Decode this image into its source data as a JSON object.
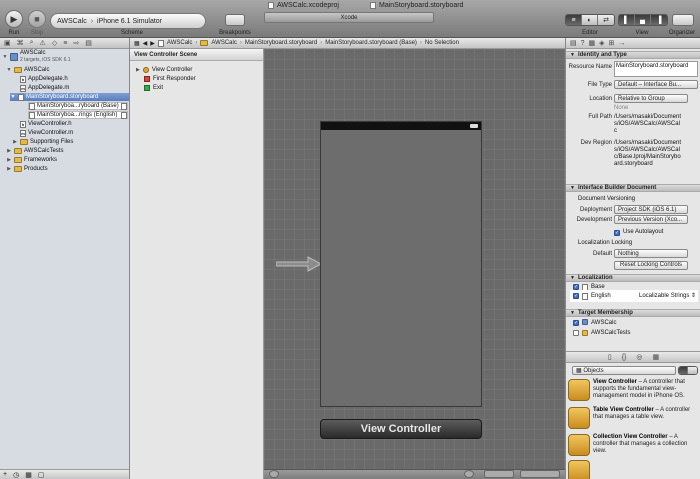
{
  "toolbar": {
    "run_label": "Run",
    "stop_label": "Stop",
    "scheme_label": "Scheme",
    "scheme_project": "AWSCalc",
    "scheme_device": "iPhone 6.1 Simulator",
    "breakpoints_label": "Breakpoints",
    "editor_label": "Editor",
    "view_label": "View",
    "organizer_label": "Organizer",
    "tab_xcodeproj": "AWSCalc.xcodeproj",
    "tab_storyboard": "MainStoryboard.storyboard",
    "xcode_tab": "Xcode"
  },
  "navigator": {
    "project": "AWSCalc",
    "project_sub": "2 targets, iOS SDK 6.1",
    "items": {
      "group": "AWSCalc",
      "appdelegate_h": "AppDelegate.h",
      "appdelegate_m": "AppDelegate.m",
      "storyboard": "MainStoryboard.storyboard",
      "sb_base": "MainStoryboa...ryboard (Base)",
      "sb_english": "MainStoryboa...rings (English)",
      "vc_h": "ViewController.h",
      "vc_m": "ViewController.m",
      "supporting": "Supporting Files",
      "tests": "AWSCalcTests",
      "frameworks": "Frameworks",
      "products": "Products"
    }
  },
  "jumpbar": {
    "c1": "AWSCalc",
    "c2": "AWSCalc",
    "c3": "MainStoryboard.storyboard",
    "c4": "MainStoryboard.storyboard (Base)",
    "c5": "No Selection"
  },
  "outline": {
    "header": "View Controller Scene",
    "vc": "View Controller",
    "fr": "First Responder",
    "exit": "Exit"
  },
  "canvas": {
    "view_controller_label": "View Controller"
  },
  "inspector": {
    "identity_header": "Identity and Type",
    "resource_name_label": "Resource Name",
    "resource_name": "MainStoryboard.storyboard",
    "file_type_label": "File Type",
    "file_type": "Default – Interface Bu...",
    "location_label": "Location",
    "location": "Relative to Group",
    "none_text": "None",
    "full_path_label": "Full Path",
    "full_path": "/Users/masaki/Documents/iOS/AWSCalc/AWSCalc",
    "dev_region_label": "Dev Region",
    "dev_region": "/Users/masaki/Documents/iOS/AWSCalc/AWSCalc/Base.lproj/MainStoryboard.storyboard",
    "ibd_header": "Interface Builder Document",
    "doc_versioning": "Document Versioning",
    "deployment_label": "Deployment",
    "deployment": "Project SDK (iOS 6.1)",
    "development_label": "Development",
    "development": "Previous Version (Xco...",
    "autolayout": "Use Autolayout",
    "loc_locking": "Localization Locking",
    "default_label": "Default",
    "default_value": "Nothing",
    "reset_button": "Reset Locking Controls",
    "localization_header": "Localization",
    "loc_base": "Base",
    "loc_english": "English",
    "loc_english_type": "Localizable Strings",
    "target_header": "Target Membership",
    "target1": "AWSCalc",
    "target2": "AWSCalcTests",
    "library_popup": "Objects",
    "lib_vc_title": "View Controller",
    "lib_vc_desc": " – A controller that supports the fundamental view-management model in iPhone OS.",
    "lib_tvc_title": "Table View Controller",
    "lib_tvc_desc": " – A controller that manages a table view.",
    "lib_cvc_title": "Collection View Controller",
    "lib_cvc_desc": " – A controller that manages a collection view."
  }
}
